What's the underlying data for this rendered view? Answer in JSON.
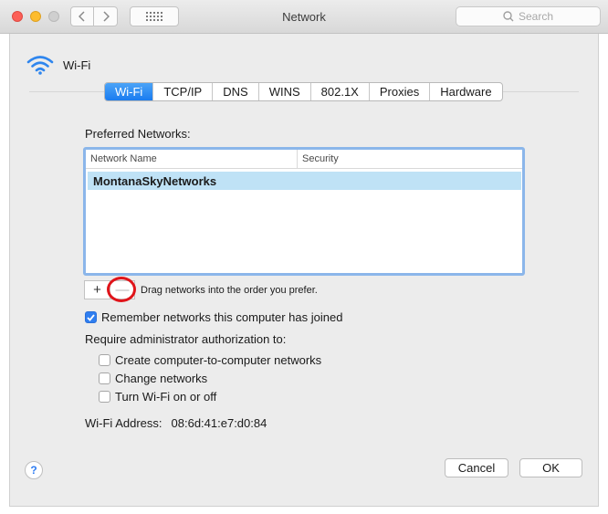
{
  "window": {
    "title": "Network",
    "search_placeholder": "Search"
  },
  "header": {
    "label": "Wi-Fi"
  },
  "tabs": [
    {
      "label": "Wi-Fi",
      "active": true
    },
    {
      "label": "TCP/IP"
    },
    {
      "label": "DNS"
    },
    {
      "label": "WINS"
    },
    {
      "label": "802.1X"
    },
    {
      "label": "Proxies"
    },
    {
      "label": "Hardware"
    }
  ],
  "preferred": {
    "label": "Preferred Networks:",
    "columns": {
      "name": "Network Name",
      "security": "Security"
    },
    "rows": [
      {
        "name": "MontanaSkyNetworks",
        "security": ""
      }
    ],
    "drag_hint": "Drag networks into the order you prefer.",
    "add_symbol": "+",
    "remove_symbol": "—"
  },
  "options": {
    "remember": {
      "label": "Remember networks this computer has joined",
      "checked": true
    },
    "admin_label": "Require administrator authorization to:",
    "admin_items": [
      {
        "label": "Create computer-to-computer networks",
        "checked": false
      },
      {
        "label": "Change networks",
        "checked": false
      },
      {
        "label": "Turn Wi-Fi on or off",
        "checked": false
      }
    ]
  },
  "address": {
    "label": "Wi-Fi Address:",
    "value": "08:6d:41:e7:d0:84"
  },
  "buttons": {
    "help": "?",
    "cancel": "Cancel",
    "ok": "OK"
  },
  "colors": {
    "accent": "#1a7cf0",
    "selection": "#bfe2f6",
    "highlight_ring": "#e0141a"
  }
}
